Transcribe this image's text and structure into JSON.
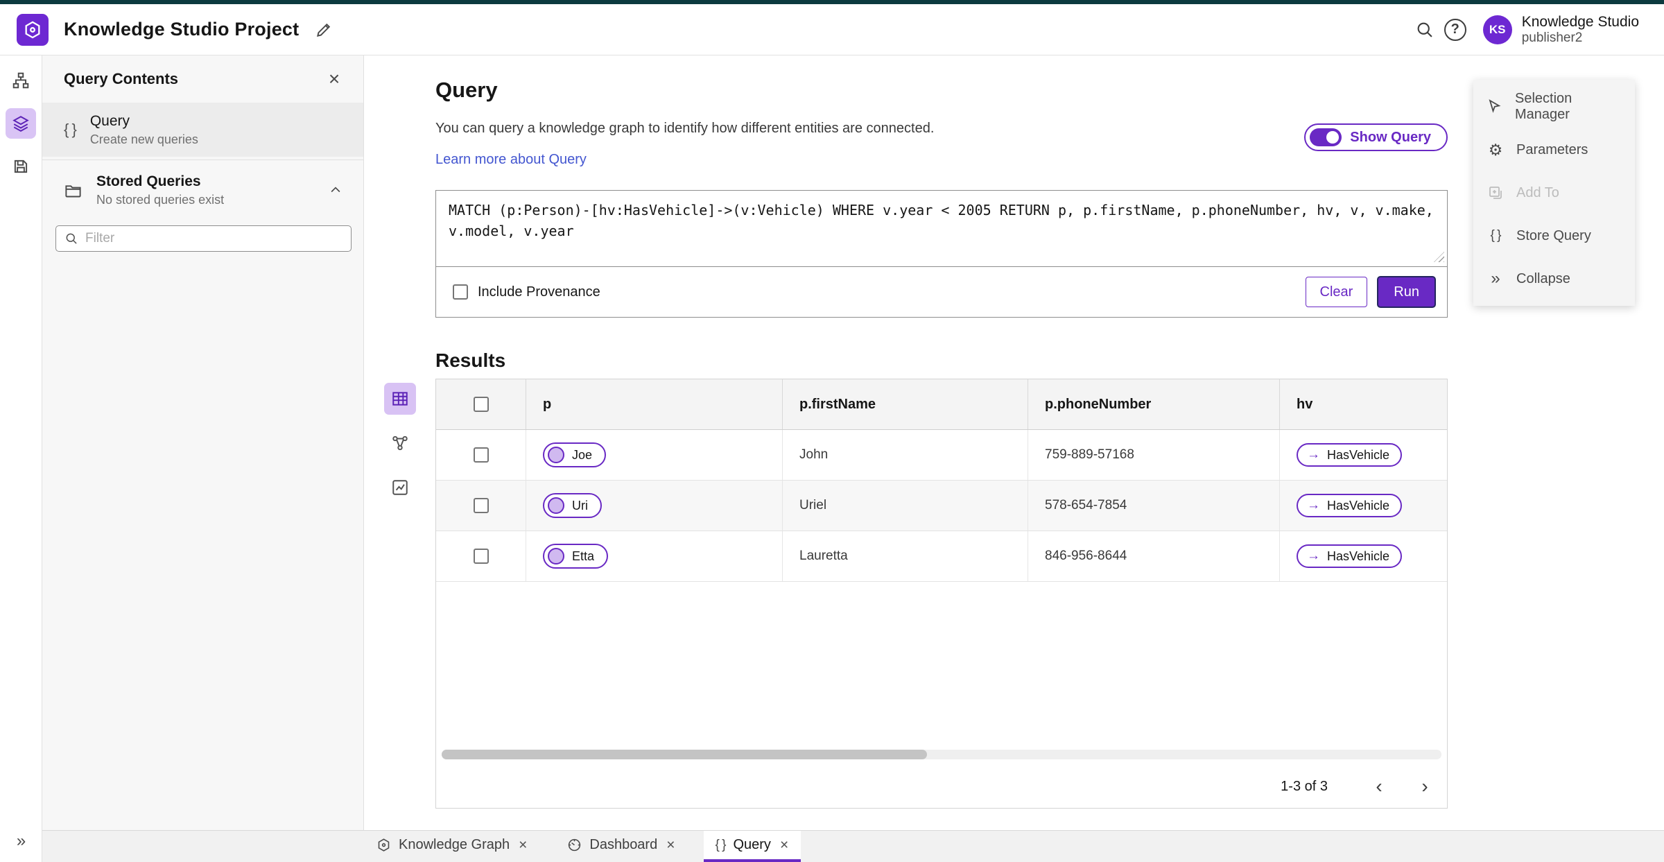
{
  "colors": {
    "accent": "#6929c4",
    "accent_deep": "#5b21b6",
    "link": "#4356d0",
    "topbar": "#0c3a3f",
    "active_icon_bg": "#d9c4f5"
  },
  "icons": {
    "braces": "{ }",
    "close": "×",
    "collapse": "»",
    "chevron_left": "‹",
    "chevron_right": "›",
    "arrow": "→",
    "gear": "⚙"
  },
  "header": {
    "title": "Knowledge Studio Project",
    "product_line1": "Knowledge Studio",
    "product_line2": "publisher2",
    "avatar": "KS"
  },
  "panel": {
    "title": "Query Contents",
    "query_label": "Query",
    "query_sub": "Create new queries",
    "stored_label": "Stored Queries",
    "stored_sub": "No stored queries exist",
    "filter_placeholder": "Filter"
  },
  "query": {
    "title": "Query",
    "description": "You can query a knowledge graph to identify how different entities are connected.",
    "learn_more": "Learn more about Query",
    "show_query": "Show Query",
    "text": "MATCH (p:Person)-[hv:HasVehicle]->(v:Vehicle) WHERE v.year < 2005 RETURN p, p.firstName, p.phoneNumber, hv, v, v.make, v.model, v.year",
    "include_provenance": "Include Provenance",
    "clear": "Clear",
    "run": "Run"
  },
  "results": {
    "title": "Results",
    "columns": [
      "p",
      "p.firstName",
      "p.phoneNumber",
      "hv"
    ],
    "rows": [
      {
        "node": "Joe",
        "firstName": "John",
        "phone": "759-889-57168",
        "edge": "HasVehicle"
      },
      {
        "node": "Uri",
        "firstName": "Uriel",
        "phone": "578-654-7854",
        "edge": "HasVehicle"
      },
      {
        "node": "Etta",
        "firstName": "Lauretta",
        "phone": "846-956-8644",
        "edge": "HasVehicle"
      }
    ],
    "pagination": "1-3 of 3"
  },
  "side_menu": {
    "items": [
      {
        "label": "Selection Manager"
      },
      {
        "label": "Parameters"
      },
      {
        "label": "Add To"
      },
      {
        "label": "Store Query"
      },
      {
        "label": "Collapse"
      }
    ]
  },
  "tabs": [
    {
      "label": "Knowledge Graph"
    },
    {
      "label": "Dashboard"
    },
    {
      "label": "Query"
    }
  ]
}
